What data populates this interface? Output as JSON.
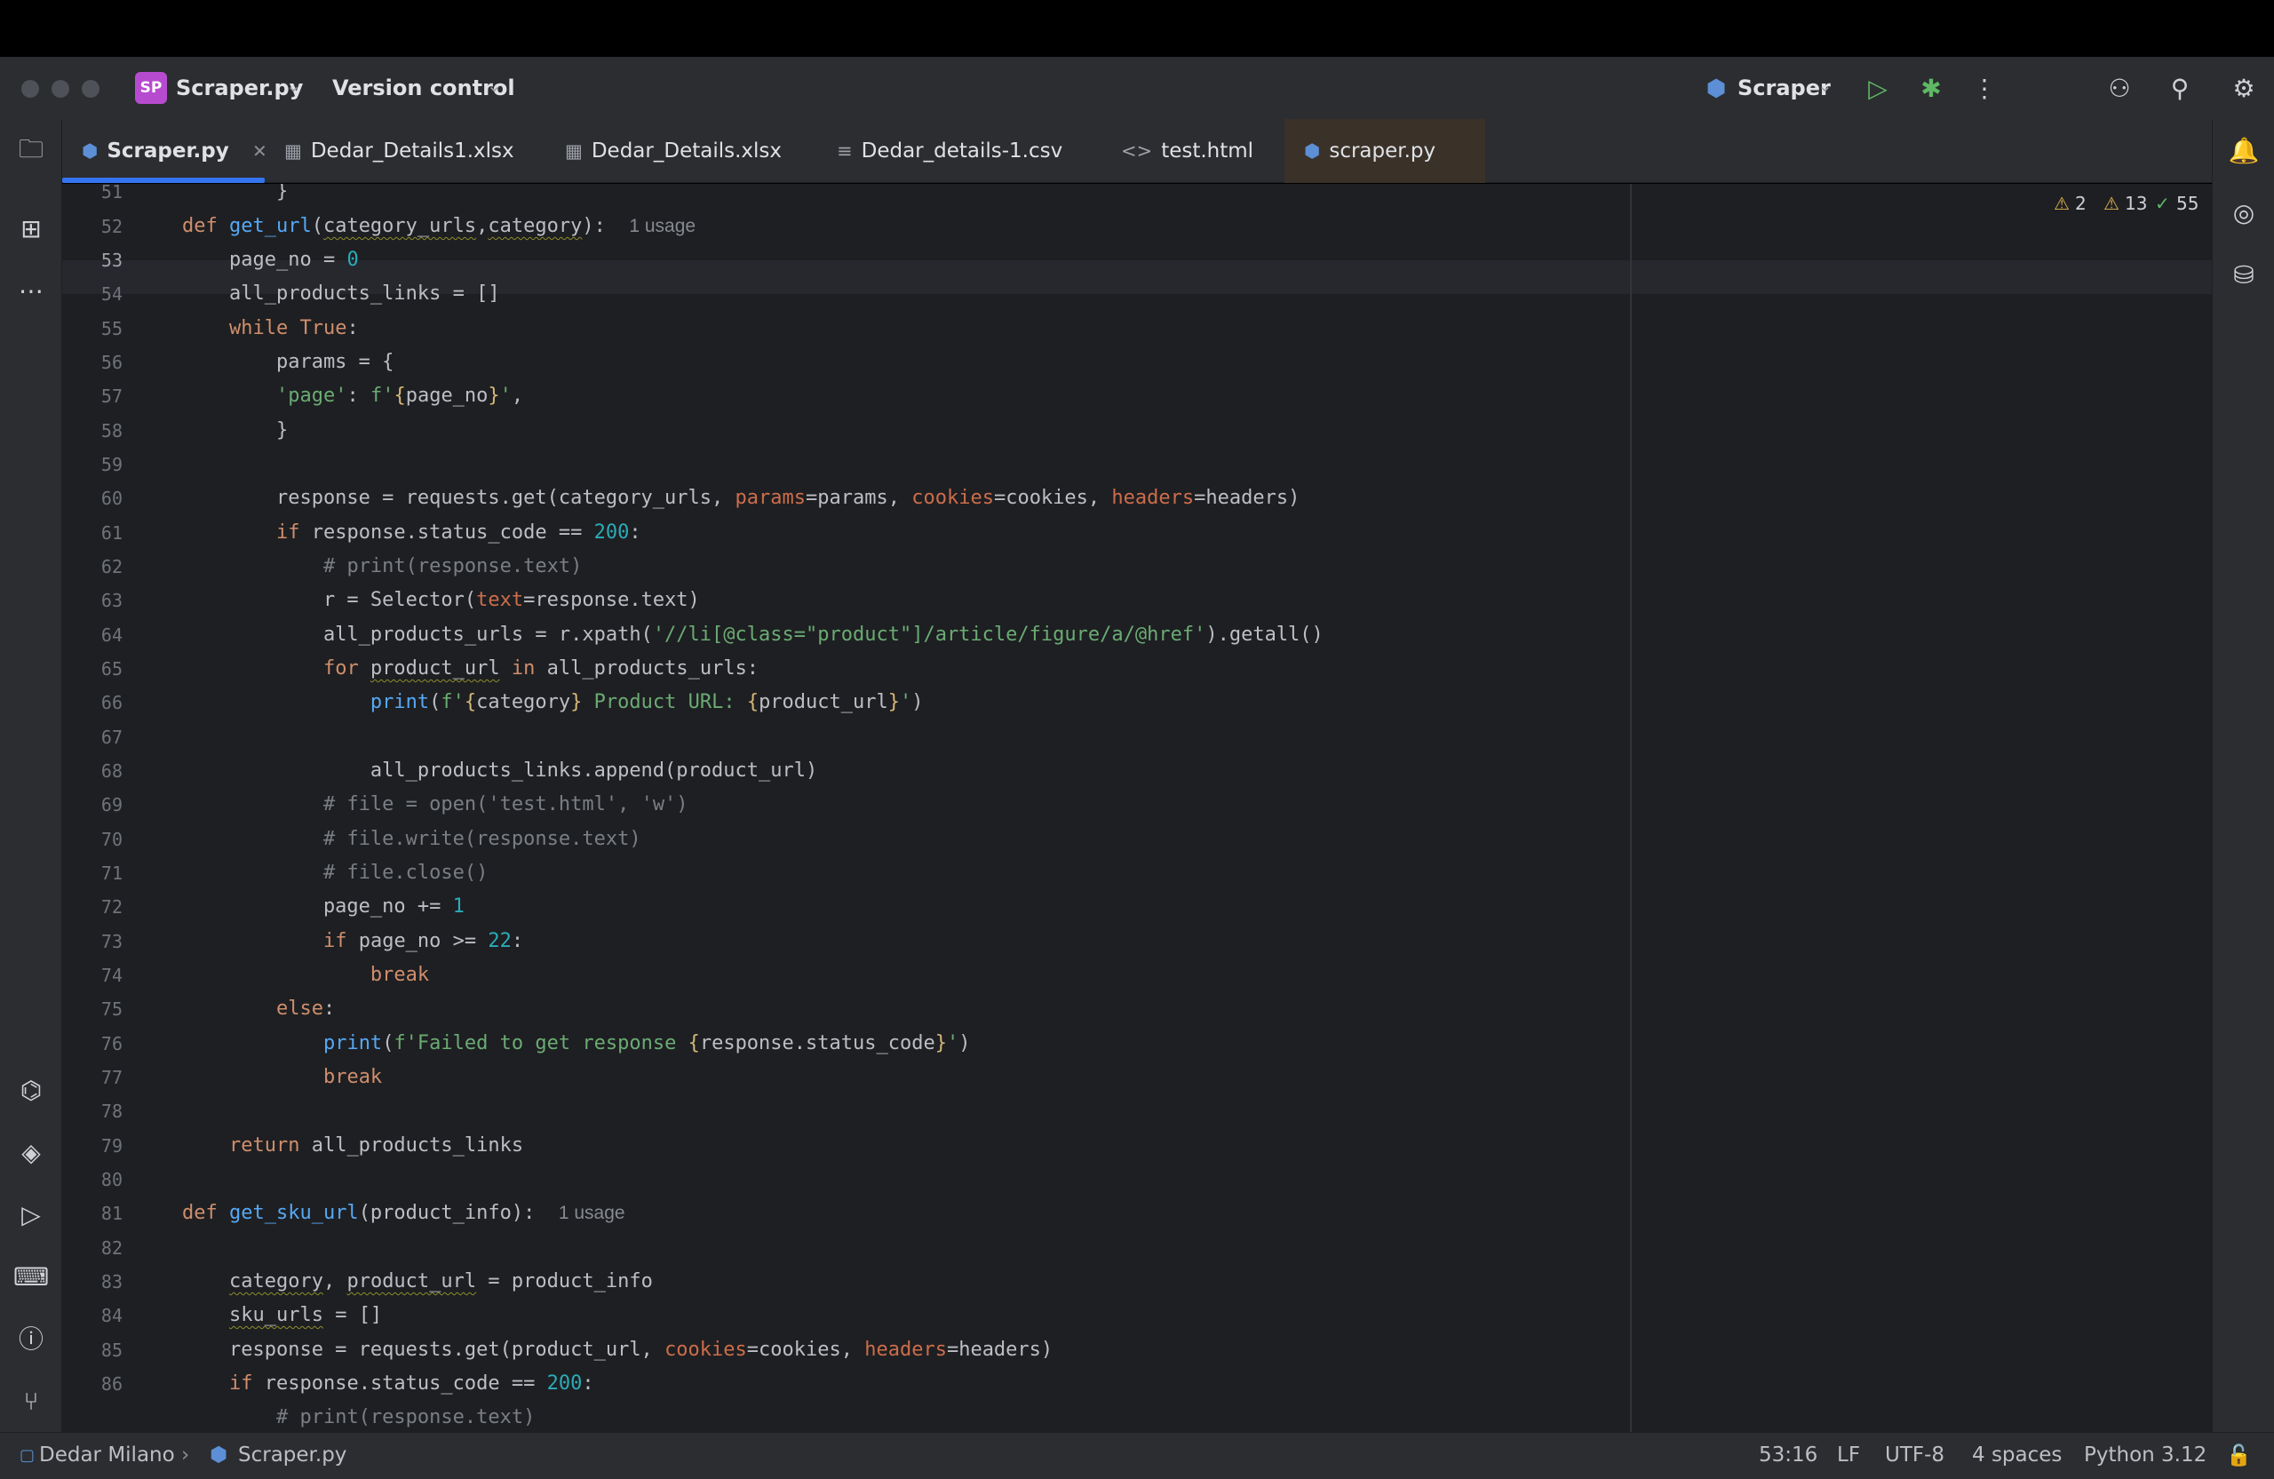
{
  "titlebar": {
    "project_badge": "SP",
    "project_name": "Scraper.py",
    "vcs": "Version control",
    "run_config": "Scraper"
  },
  "tabs": [
    {
      "label": "Scraper.py",
      "icon": "python-icon",
      "active": true
    },
    {
      "label": "Dedar_Details1.xlsx",
      "icon": "table-icon"
    },
    {
      "label": "Dedar_Details.xlsx",
      "icon": "table-icon"
    },
    {
      "label": "Dedar_details-1.csv",
      "icon": "csv-icon"
    },
    {
      "label": "test.html",
      "icon": "html-icon"
    },
    {
      "label": "scraper.py",
      "icon": "python-icon"
    }
  ],
  "inspections": {
    "errors": "2",
    "warnings": "13",
    "ok": "55"
  },
  "editor": {
    "current_line": "53",
    "line_numbers": [
      "51",
      "52",
      "53",
      "54",
      "55",
      "56",
      "57",
      "58",
      "59",
      "60",
      "61",
      "62",
      "63",
      "64",
      "65",
      "66",
      "67",
      "68",
      "69",
      "70",
      "71",
      "72",
      "73",
      "74",
      "75",
      "76",
      "77",
      "78",
      "79",
      "80",
      "81",
      "82",
      "83",
      "84",
      "85",
      "86"
    ],
    "usage_hint": "1 usage"
  },
  "statusbar": {
    "project": "Dedar Milano",
    "file": "Scraper.py",
    "position": "53:16",
    "line_sep": "LF",
    "encoding": "UTF-8",
    "indent": "4 spaces",
    "interpreter": "Python 3.12"
  }
}
